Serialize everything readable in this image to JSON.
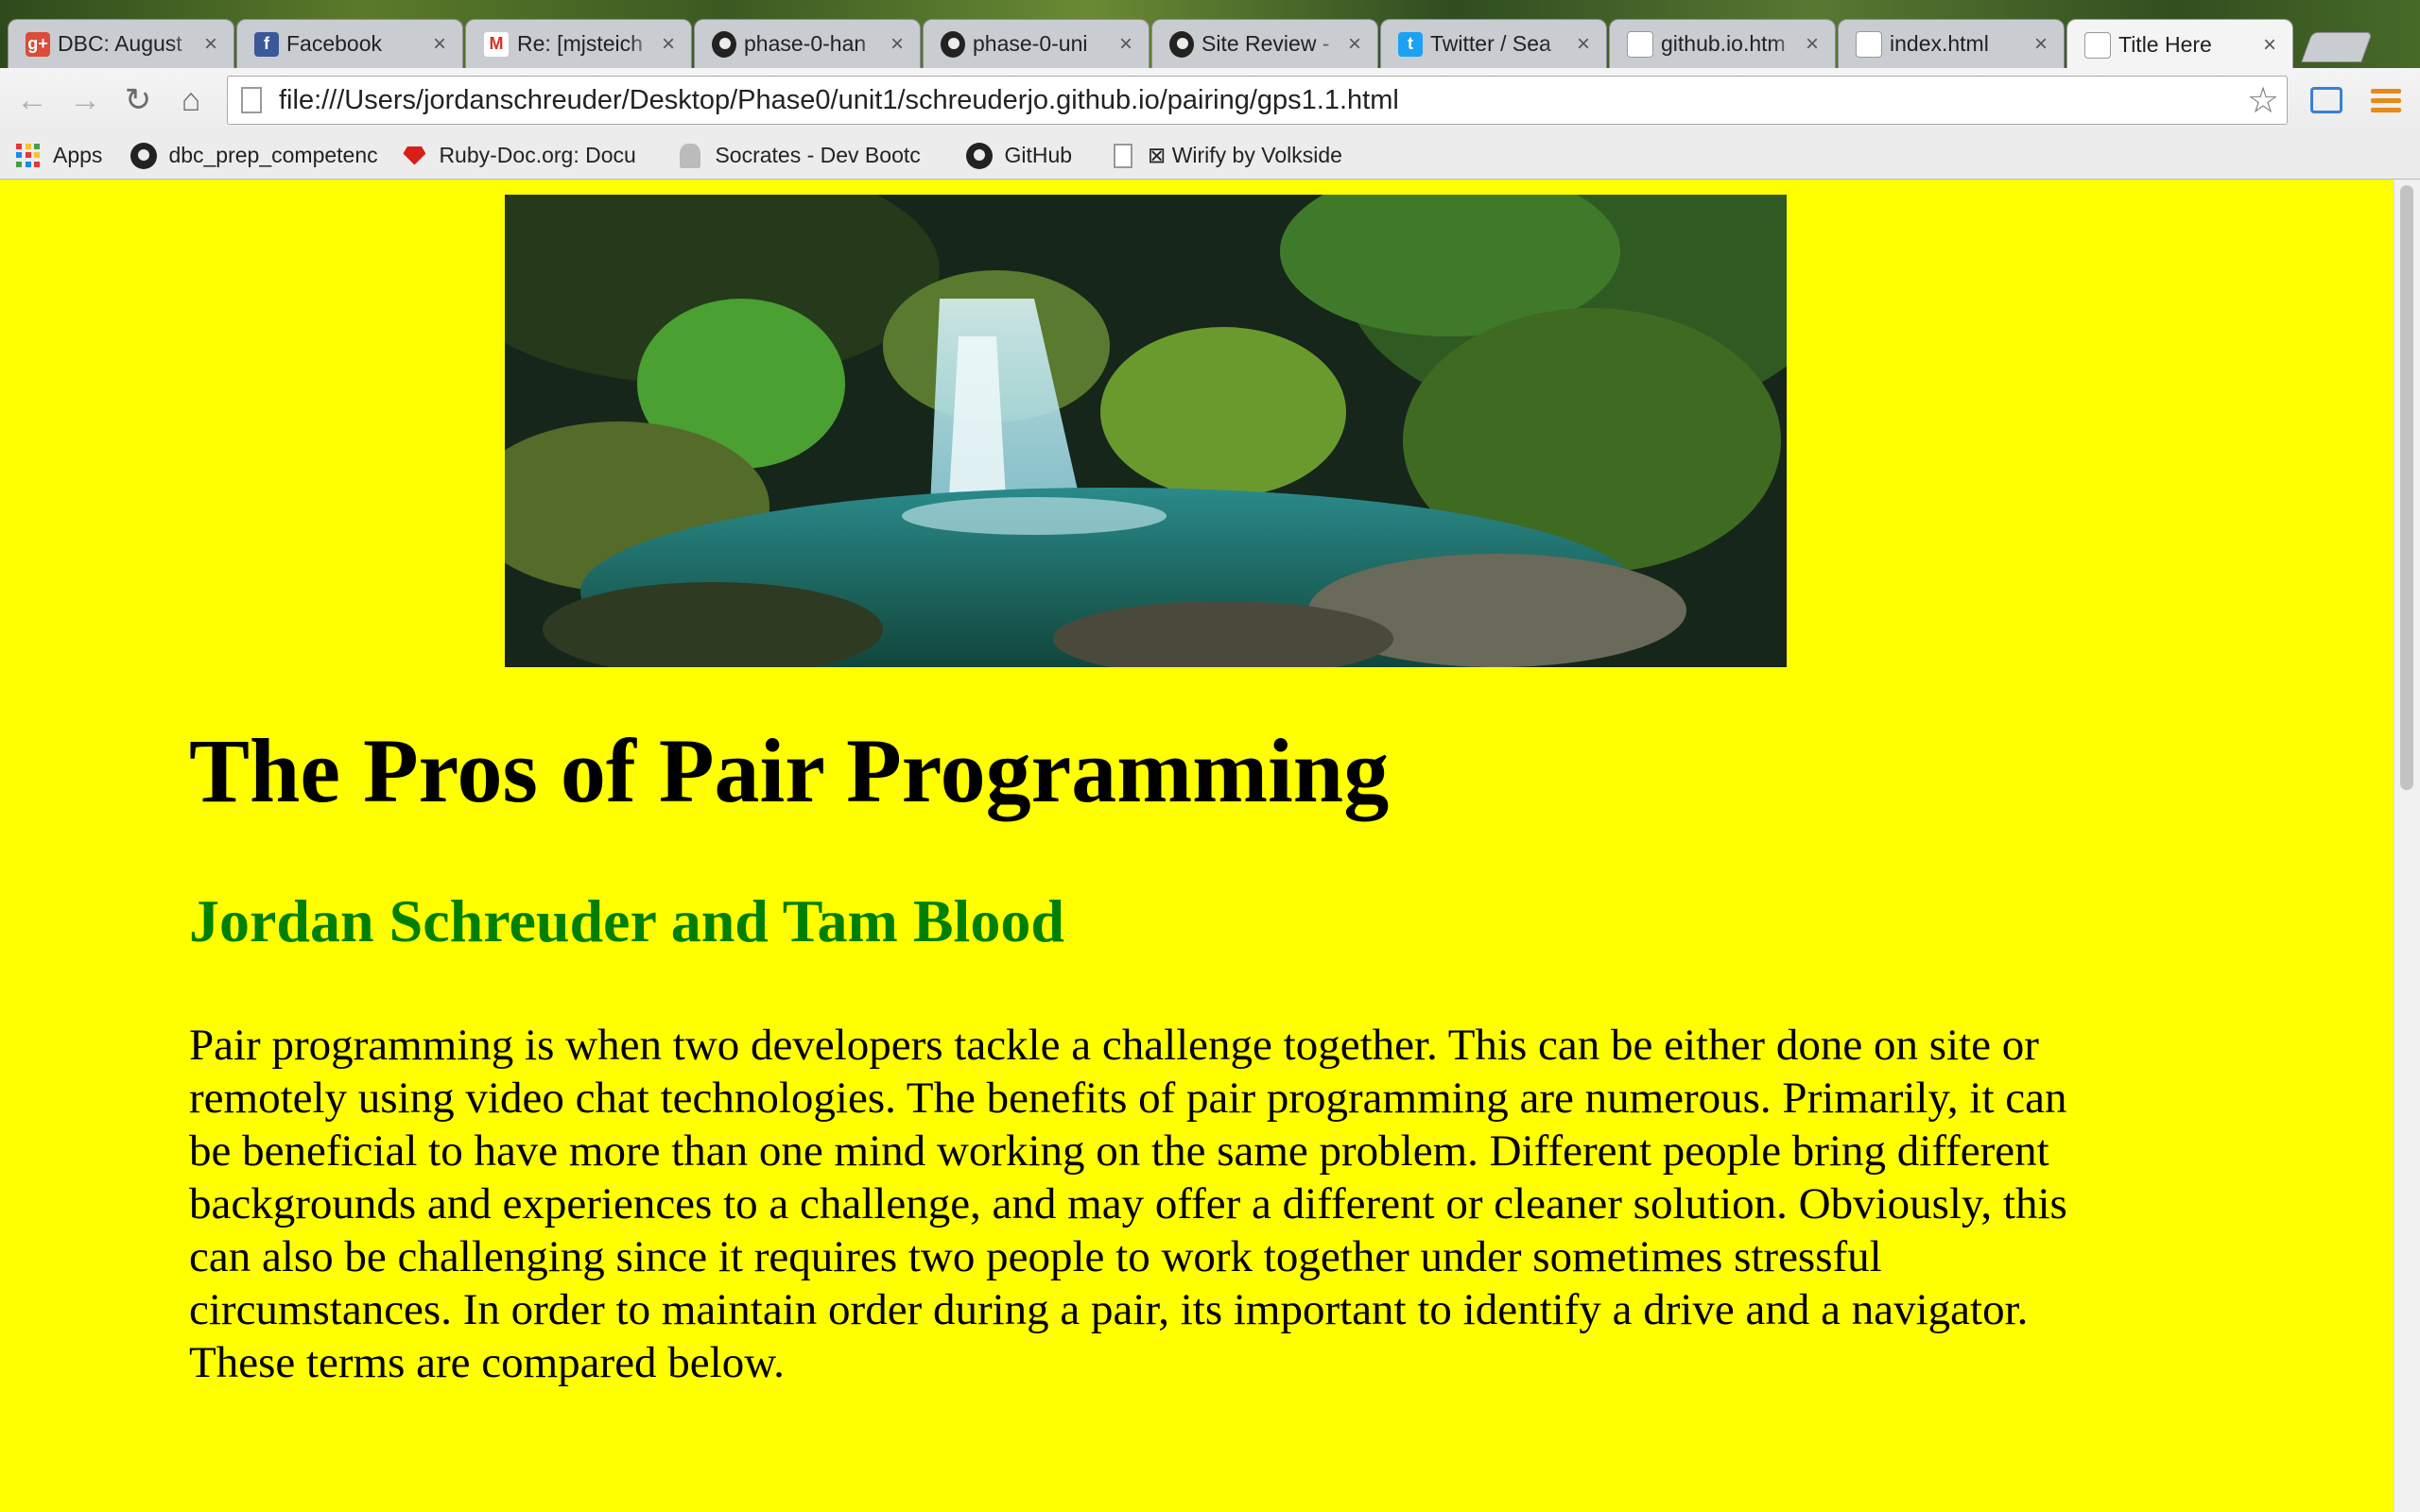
{
  "browser": {
    "tabs": [
      {
        "label": "DBC: August",
        "icon": "google-plus-icon",
        "active": false
      },
      {
        "label": "Facebook",
        "icon": "facebook-icon",
        "active": false
      },
      {
        "label": "Re: [mjsteich",
        "icon": "gmail-icon",
        "active": false
      },
      {
        "label": "phase-0-han",
        "icon": "github-icon",
        "active": false
      },
      {
        "label": "phase-0-uni",
        "icon": "github-icon",
        "active": false
      },
      {
        "label": "Site Review -",
        "icon": "github-icon",
        "active": false
      },
      {
        "label": "Twitter / Sea",
        "icon": "twitter-icon",
        "active": false
      },
      {
        "label": "github.io.htm",
        "icon": "page-icon",
        "active": false
      },
      {
        "label": "index.html",
        "icon": "page-icon",
        "active": false
      },
      {
        "label": "Title Here",
        "icon": "page-icon",
        "active": true
      }
    ],
    "url": "file:///Users/jordanschreuder/Desktop/Phase0/unit1/schreuderjo.github.io/pairing/gps1.1.html",
    "bookmarks": [
      {
        "label": "Apps",
        "icon": "apps-grid-icon"
      },
      {
        "label": "dbc_prep_competenc",
        "icon": "github-icon"
      },
      {
        "label": "Ruby-Doc.org: Docu",
        "icon": "ruby-icon"
      },
      {
        "label": "Socrates - Dev Bootc",
        "icon": "socrates-icon"
      },
      {
        "label": "GitHub",
        "icon": "github-icon"
      },
      {
        "label": "⊠ Wirify by Volkside",
        "icon": "page-icon"
      }
    ],
    "colors": {
      "tab_close": "#555555",
      "omnibox_text": "#222222",
      "menu_accent": "#e88a1a",
      "cast_accent": "#3a7fd5"
    }
  },
  "page": {
    "background": "#ffff00",
    "hero_image": "waterfall-landscape",
    "title": "The Pros of Pair Programming",
    "authors": "Jordan Schreuder and Tam Blood",
    "authors_color": "#008000",
    "intro": "Pair programming is when two developers tackle a challenge together. This can be either done on site or remotely using video chat technologies. The benefits of pair programming are numerous. Primarily, it can be beneficial to have more than one mind working on the same problem. Different people bring different backgrounds and experiences to a challenge, and may offer a different or cleaner solution. Obviously, this can also be challenging since it requires two people to work together under sometimes stressful circumstances. In order to maintain order during a pair, its important to identify a drive and a navigator. These terms are compared below."
  }
}
